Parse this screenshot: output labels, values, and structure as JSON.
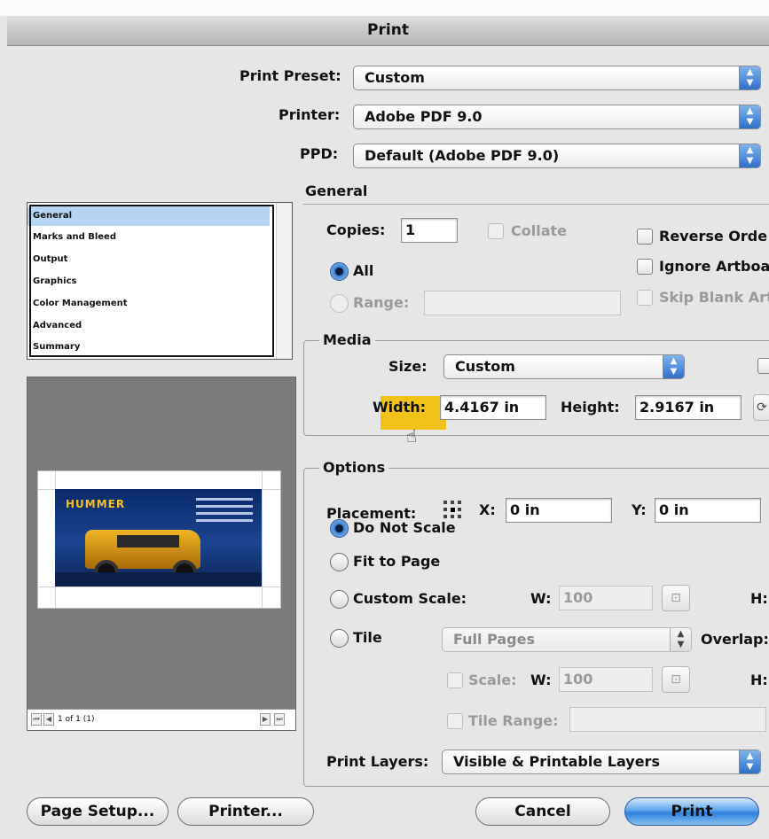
{
  "window": {
    "title": "Print"
  },
  "top": {
    "print_preset_label": "Print Preset:",
    "print_preset_value": "Custom",
    "printer_label": "Printer:",
    "printer_value": "Adobe PDF 9.0",
    "ppd_label": "PPD:",
    "ppd_value": "Default (Adobe PDF 9.0)"
  },
  "sidebar": {
    "items": [
      {
        "label": "General",
        "selected": true
      },
      {
        "label": "Marks and Bleed"
      },
      {
        "label": "Output"
      },
      {
        "label": "Graphics"
      },
      {
        "label": "Color Management"
      },
      {
        "label": "Advanced"
      },
      {
        "label": "Summary"
      }
    ]
  },
  "preview": {
    "card_brand": "HUMMER",
    "page_indicator": "1 of 1 (1)"
  },
  "general": {
    "section_title": "General",
    "copies_label": "Copies:",
    "copies_value": "1",
    "collate_label": "Collate",
    "reverse_order_label": "Reverse Orde",
    "ignore_artboards_label": "Ignore Artboa",
    "skip_blank_label": "Skip Blank Art",
    "all_label": "All",
    "range_label": "Range:"
  },
  "media": {
    "group_label": "Media",
    "size_label": "Size:",
    "size_value": "Custom",
    "width_label": "Width:",
    "width_value": "4.4167 in",
    "height_label": "Height:",
    "height_value": "2.9167 in"
  },
  "options": {
    "group_label": "Options",
    "placement_label": "Placement:",
    "x_label": "X:",
    "x_value": "0 in",
    "y_label": "Y:",
    "y_value": "0 in",
    "do_not_scale_label": "Do Not Scale",
    "fit_to_page_label": "Fit to Page",
    "custom_scale_label": "Custom Scale:",
    "w_label": "W:",
    "w_value": "100",
    "h_label": "H:",
    "tile_label": "Tile",
    "tile_value": "Full Pages",
    "overlap_label": "Overlap:",
    "scale_label": "Scale:",
    "scale_w_label": "W:",
    "scale_w_value": "100",
    "scale_h_label": "H:",
    "tile_range_label": "Tile Range:",
    "print_layers_label": "Print Layers:",
    "print_layers_value": "Visible & Printable Layers"
  },
  "buttons": {
    "page_setup": "Page Setup...",
    "printer": "Printer...",
    "cancel": "Cancel",
    "print": "Print"
  },
  "colors": {
    "accent": "#3b82d8",
    "highlight": "#f2c21a",
    "selection": "#b5d5f5"
  }
}
